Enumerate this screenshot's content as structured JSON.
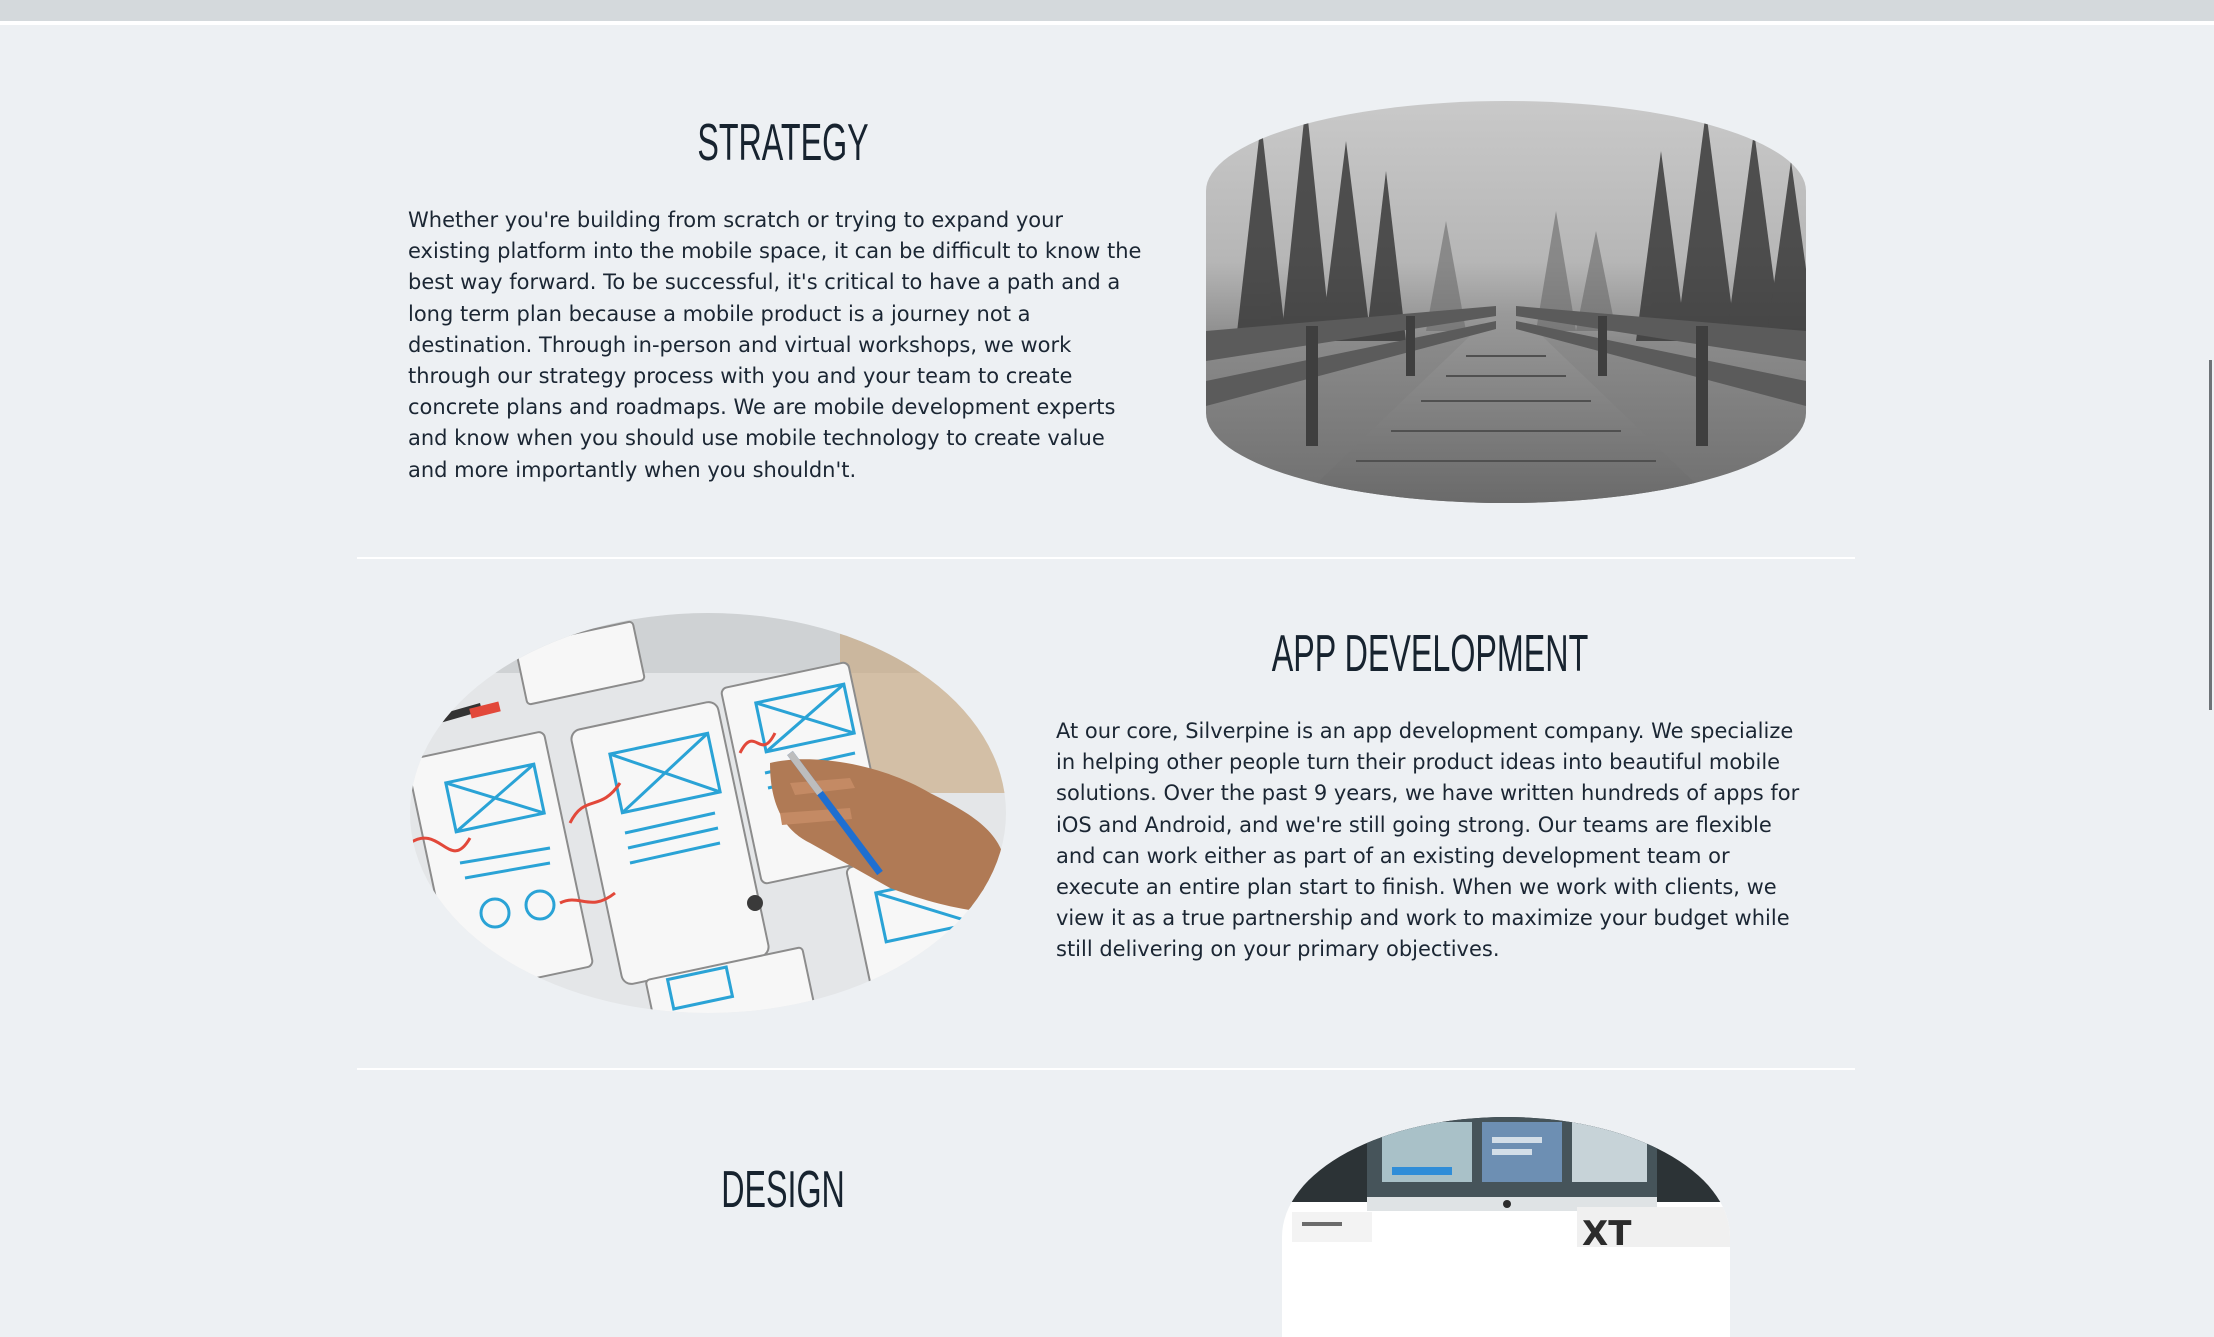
{
  "sections": [
    {
      "title": "STRATEGY",
      "body": "Whether you're building from scratch or trying to expand your existing platform into the mobile space, it can be difficult to know the best way forward. To be successful, it's critical to have a path and a long term plan because a mobile product is a journey not a destination. Through in-person and virtual workshops, we work through our strategy process with you and your team to create concrete plans and roadmaps. We are mobile development experts and know when you should use mobile technology to create value and more importantly when you shouldn't.",
      "image": "forest-boardwalk-photo"
    },
    {
      "title": "APP DEVELOPMENT",
      "body": "At our core, Silverpine is an app development company. We specialize in helping other people turn their product ideas into beautiful mobile solutions. Over the past 9 years, we have written hundreds of apps for iOS and Android, and we're still going strong. Our teams are flexible and can work either as part of an existing development team or execute an entire plan start to finish. When we work with clients, we view it as a true partnership and work to maximize your budget while still delivering on your primary objectives.",
      "image": "wireframe-sketching-photo"
    },
    {
      "title": "DESIGN",
      "image": "computer-monitor-photo"
    }
  ],
  "colors": {
    "background": "#edf0f3",
    "text": "#1b2633",
    "divider": "#ffffff"
  }
}
